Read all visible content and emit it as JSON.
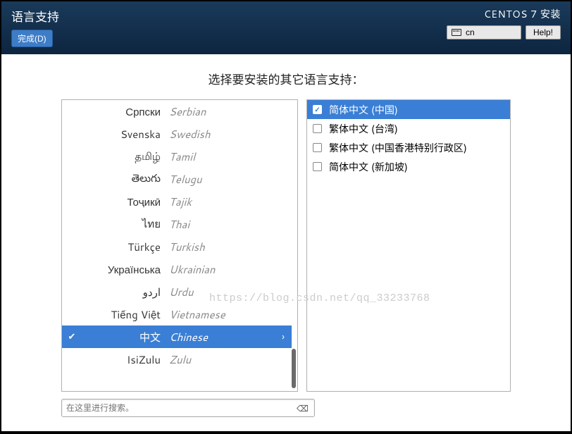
{
  "header": {
    "title": "语言支持",
    "done_label": "完成(D)",
    "install_title": "CENTOS 7 安装",
    "kb_layout": "cn",
    "help_label": "Help!"
  },
  "subtitle": "选择要安装的其它语言支持：",
  "languages": [
    {
      "native": "Српски",
      "english": "Serbian",
      "selected": false
    },
    {
      "native": "Svenska",
      "english": "Swedish",
      "selected": false
    },
    {
      "native": "தமிழ்",
      "english": "Tamil",
      "selected": false
    },
    {
      "native": "తెలుగు",
      "english": "Telugu",
      "selected": false
    },
    {
      "native": "Тоҷикӣ",
      "english": "Tajik",
      "selected": false
    },
    {
      "native": "ไทย",
      "english": "Thai",
      "selected": false
    },
    {
      "native": "Türkçe",
      "english": "Turkish",
      "selected": false
    },
    {
      "native": "Українська",
      "english": "Ukrainian",
      "selected": false
    },
    {
      "native": "اردو",
      "english": "Urdu",
      "selected": false
    },
    {
      "native": "Tiếng Việt",
      "english": "Vietnamese",
      "selected": false
    },
    {
      "native": "中文",
      "english": "Chinese",
      "selected": true
    },
    {
      "native": "IsiZulu",
      "english": "Zulu",
      "selected": false
    }
  ],
  "locales": [
    {
      "label": "简体中文 (中国)",
      "checked": true,
      "selected": true
    },
    {
      "label": "繁体中文 (台湾)",
      "checked": false,
      "selected": false
    },
    {
      "label": "繁体中文 (中国香港特别行政区)",
      "checked": false,
      "selected": false
    },
    {
      "label": "简体中文 (新加坡)",
      "checked": false,
      "selected": false
    }
  ],
  "search": {
    "placeholder": "在这里进行搜索。"
  },
  "watermark": "https://blog.csdn.net/qq_33233768"
}
